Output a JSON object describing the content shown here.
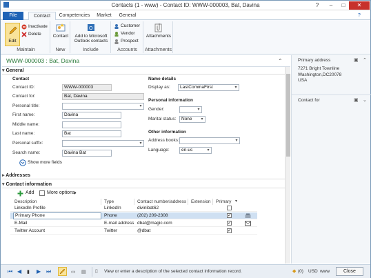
{
  "window": {
    "title": "Contacts (1 - www) - Contact ID: WWW-000003, Bat, Davina"
  },
  "tabs": [
    {
      "label": "File"
    },
    {
      "label": "Contact"
    },
    {
      "label": "Competencies"
    },
    {
      "label": "Market"
    },
    {
      "label": "General"
    }
  ],
  "ribbon": {
    "edit": "Edit",
    "inactivate": "Inactivate",
    "delete": "Delete",
    "maintain": "Maintain",
    "contact": "Contact",
    "new": "New",
    "add_outlook_1": "Add to Microsoft",
    "add_outlook_2": "Outlook contacts",
    "include": "Include",
    "customer": "Customer",
    "vendor": "Vendor",
    "prospect": "Prospect",
    "accounts": "Accounts",
    "attachments": "Attachments",
    "attachments_group": "Attachments"
  },
  "record_title": "WWW-000003 : Bat, Davina",
  "general": {
    "section": "General",
    "contact_header": "Contact",
    "contact_id_label": "Contact ID:",
    "contact_id": "WWW-000003",
    "contact_for_label": "Contact for:",
    "contact_for": "Bat, Davina",
    "personal_title_label": "Personal title:",
    "personal_title": "",
    "first_name_label": "First name:",
    "first_name": "Davina",
    "middle_name_label": "Middle name:",
    "middle_name": "",
    "last_name_label": "Last name:",
    "last_name": "Bat",
    "personal_suffix_label": "Personal suffix:",
    "personal_suffix": "",
    "search_name_label": "Search name:",
    "search_name": "Davina Bat",
    "show_more": "Show more fields",
    "name_details": "Name details",
    "display_as_label": "Display as:",
    "display_as": "LastCommaFirst",
    "personal_info": "Personal information",
    "gender_label": "Gender:",
    "gender": "",
    "marital_label": "Marital status:",
    "marital": "None",
    "other_info": "Other information",
    "address_books_label": "Address books:",
    "address_books": "",
    "language_label": "Language:",
    "language": "en-us"
  },
  "addresses": {
    "section": "Addresses"
  },
  "contact_information": {
    "section": "Contact information",
    "add": "Add",
    "more_options": "More options",
    "columns": [
      "Description",
      "Type",
      "Contact number/address",
      "Extension",
      "Primary"
    ],
    "rows": [
      {
        "description": "LinkedIn Profile",
        "type": "LinkedIn",
        "contact": "divinibat62",
        "extension": "",
        "primary": ""
      },
      {
        "description": "Primary Phone",
        "type": "Phone",
        "contact": "(202) 209-2308",
        "extension": "",
        "primary": "✓"
      },
      {
        "description": "E-Mail",
        "type": "E-mail address",
        "contact": "dbat@magic.com",
        "extension": "",
        "primary": "✓"
      },
      {
        "description": "Twitter Account",
        "type": "Twitter",
        "contact": "@dbat",
        "extension": "",
        "primary": "✓"
      }
    ]
  },
  "right_pane": {
    "primary_address": "Primary address",
    "address_line1": "7271 Bright Townline",
    "address_line2": "Washington,DC20078",
    "address_line3": "USA",
    "contact_for": "Contact for"
  },
  "status": {
    "help": "View or enter a description of the selected contact information record.",
    "count": "(0)",
    "currency": "USD",
    "company": "www",
    "close": "Close"
  }
}
